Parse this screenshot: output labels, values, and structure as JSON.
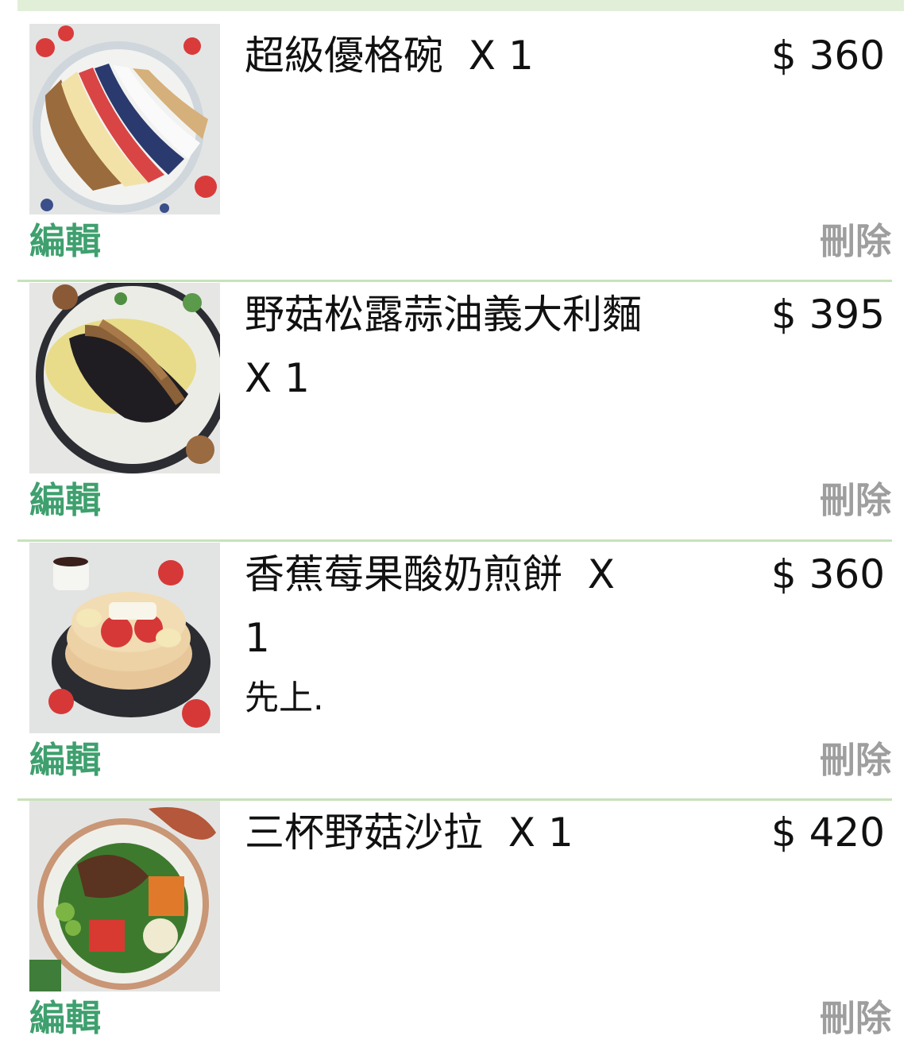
{
  "cart": {
    "items": [
      {
        "name": "超級優格碗",
        "quantity": "X 1",
        "price": "$ 360",
        "note": "",
        "edit_label": "編輯",
        "delete_label": "刪除"
      },
      {
        "name": "野菇松露蒜油義大利麵",
        "quantity": "X 1",
        "price": "$ 395",
        "note": "",
        "edit_label": "編輯",
        "delete_label": "刪除"
      },
      {
        "name": "香蕉莓果酸奶煎餅",
        "quantity": "X 1",
        "price": "$ 360",
        "note": "先上.",
        "edit_label": "編輯",
        "delete_label": "刪除"
      },
      {
        "name": "三杯野菇沙拉",
        "quantity": "X 1",
        "price": "$ 420",
        "note": "",
        "edit_label": "編輯",
        "delete_label": "刪除"
      }
    ]
  },
  "colors": {
    "edit": "#3ea06e",
    "delete": "#9e9e9e",
    "divider": "#c7e2b9",
    "top_bar": "#e1efd9"
  }
}
